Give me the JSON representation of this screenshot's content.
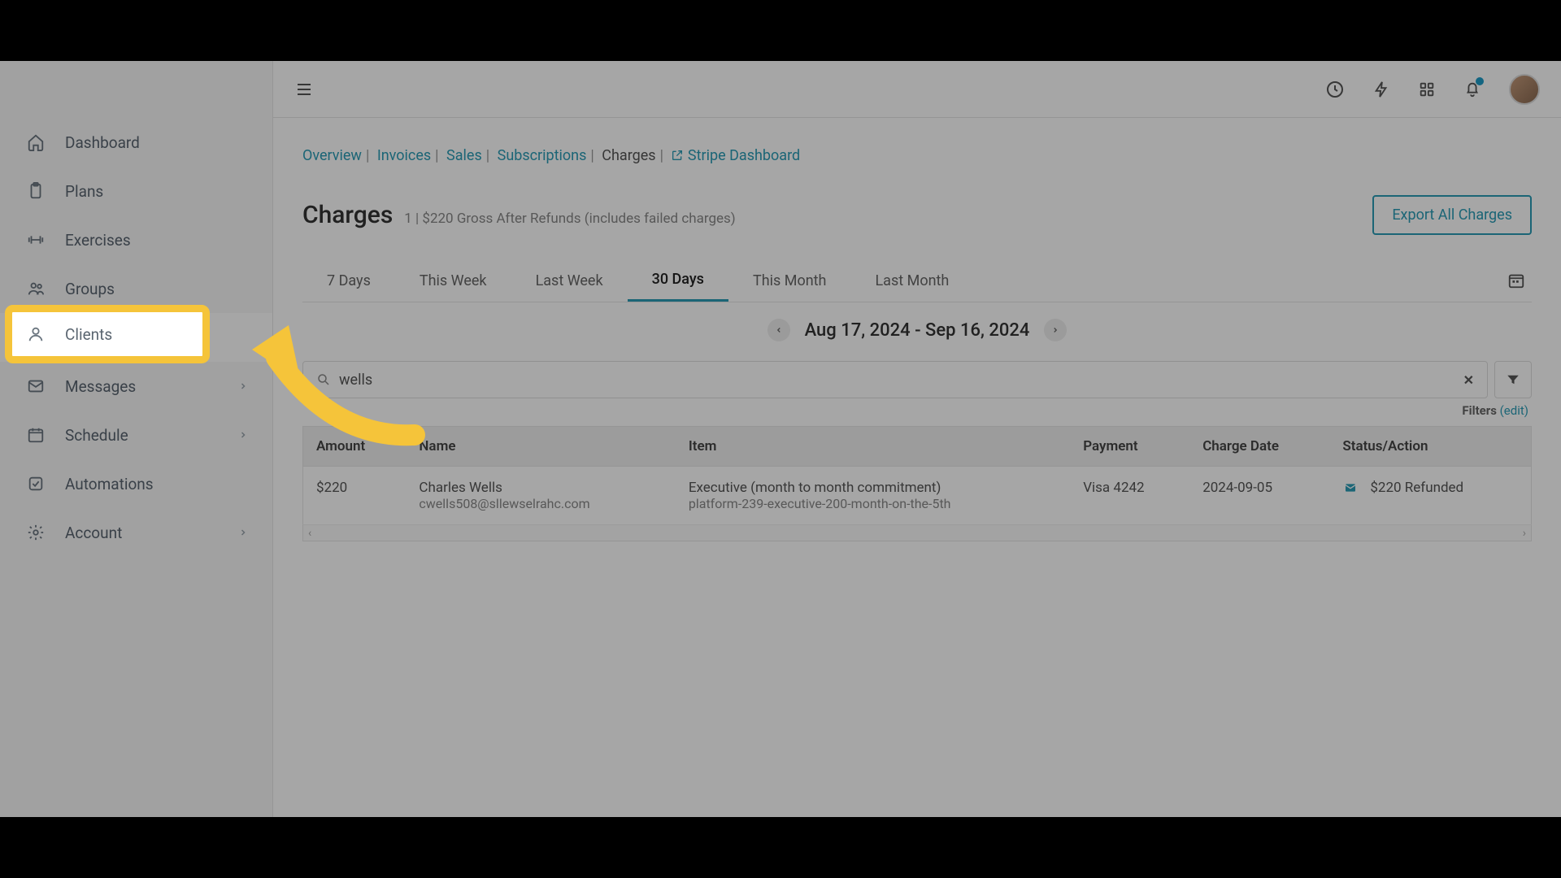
{
  "sidebar": {
    "items": [
      {
        "label": "Dashboard"
      },
      {
        "label": "Plans"
      },
      {
        "label": "Exercises"
      },
      {
        "label": "Groups"
      },
      {
        "label": "Clients"
      },
      {
        "label": "Messages"
      },
      {
        "label": "Schedule"
      },
      {
        "label": "Automations"
      },
      {
        "label": "Account"
      }
    ]
  },
  "breadcrumb": {
    "overview": "Overview",
    "invoices": "Invoices",
    "sales": "Sales",
    "subscriptions": "Subscriptions",
    "charges": "Charges",
    "stripe": "Stripe Dashboard"
  },
  "page": {
    "title": "Charges",
    "summary": "1 | $220 Gross After Refunds (includes failed charges)",
    "export_label": "Export All Charges"
  },
  "tabs": {
    "t0": "7 Days",
    "t1": "This Week",
    "t2": "Last Week",
    "t3": "30 Days",
    "t4": "This Month",
    "t5": "Last Month"
  },
  "date_range": "Aug 17, 2024 - Sep 16, 2024",
  "search": {
    "value": "wells"
  },
  "filters": {
    "label": "Filters",
    "edit": "(edit)"
  },
  "table": {
    "headers": {
      "amount": "Amount",
      "name": "Name",
      "item": "Item",
      "payment": "Payment",
      "charge_date": "Charge Date",
      "status": "Status/Action"
    },
    "rows": [
      {
        "amount": "$220",
        "name": "Charles Wells",
        "email": "cwells508@sllewselrahc.com",
        "item_title": "Executive (month to month commitment)",
        "item_sub": "platform-239-executive-200-month-on-the-5th",
        "payment": "Visa 4242",
        "date": "2024-09-05",
        "status": "$220 Refunded"
      }
    ]
  }
}
